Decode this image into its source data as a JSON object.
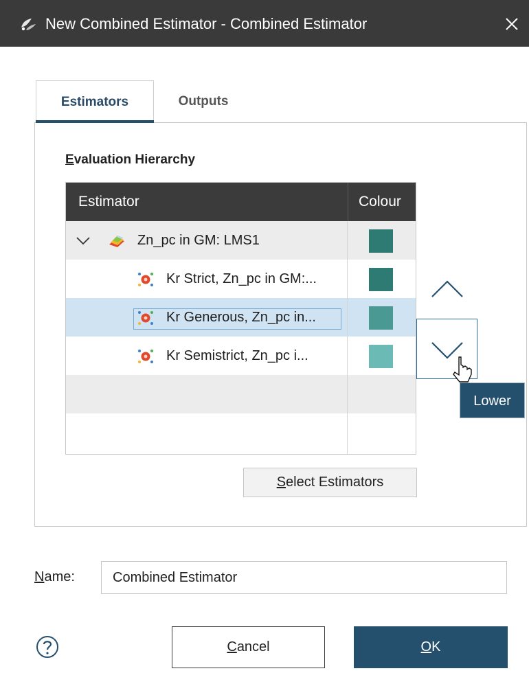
{
  "window": {
    "title": "New Combined Estimator - Combined Estimator",
    "app_icon": "leapfrog-app-icon",
    "close_icon": "close-icon"
  },
  "tabs": [
    {
      "label": "Estimators",
      "active": true
    },
    {
      "label": "Outputs",
      "active": false
    }
  ],
  "hierarchy": {
    "title_mnemonic": "E",
    "title_rest": "valuation Hierarchy",
    "columns": {
      "estimator": "Estimator",
      "colour": "Colour"
    },
    "rows": [
      {
        "label": "Zn_pc in GM: LMS1",
        "color": "#2e7b74",
        "icon": "domain-estimation-icon",
        "expanded": true
      },
      {
        "label": "Kr Strict, Zn_pc in GM:...",
        "color": "#2e7b74",
        "icon": "kriging-estimator-icon"
      },
      {
        "label": "Kr Generous, Zn_pc in...",
        "color": "#4a9a93",
        "icon": "kriging-estimator-icon",
        "selected": true
      },
      {
        "label": "Kr Semistrict, Zn_pc i...",
        "color": "#6bbab5",
        "icon": "kriging-estimator-icon"
      }
    ],
    "row_colors": {
      "group": "#ececec",
      "child": "#ffffff",
      "selected": "#cfe3f3",
      "empty": "#ececec"
    }
  },
  "controls": {
    "raise_icon": "chevron-up-icon",
    "lower_icon": "chevron-down-icon",
    "tooltip": "Lower"
  },
  "select_button": {
    "mnemonic": "S",
    "rest": "elect Estimators"
  },
  "name_field": {
    "label_mnemonic": "N",
    "label_rest": "ame:",
    "value": "Combined Estimator"
  },
  "buttons": {
    "help_icon": "help-icon",
    "cancel_mnemonic": "C",
    "cancel_rest": "ancel",
    "ok_mnemonic": "O",
    "ok_rest": "K"
  },
  "colors": {
    "accent": "#24506e",
    "titlebar": "#3a3a3a",
    "table_header": "#3b3b3b"
  }
}
